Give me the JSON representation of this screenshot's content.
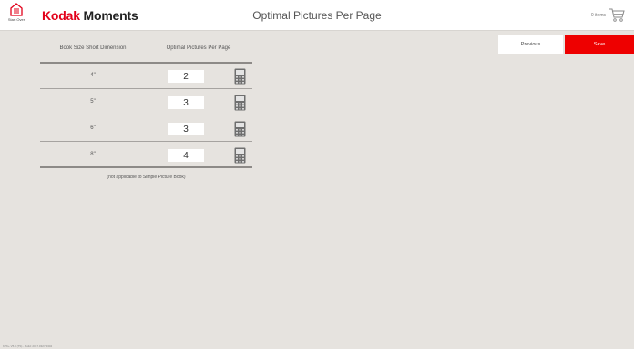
{
  "header": {
    "home_label": "Start Over",
    "brand_primary": "Kodak",
    "brand_secondary": "Moments",
    "title": "Optimal Pictures Per Page",
    "cart_count": "0 items"
  },
  "actions": {
    "previous_label": "Previous",
    "save_label": "Save"
  },
  "table": {
    "col_size": "Book Size Short Dimension",
    "col_optimal": "Optimal Pictures Per Page",
    "rows": [
      {
        "size": "4\"",
        "value": "2"
      },
      {
        "size": "5\"",
        "value": "3"
      },
      {
        "size": "6\"",
        "value": "3"
      },
      {
        "size": "8\"",
        "value": "4"
      }
    ],
    "note": "(not applicable to Simple Picture Book)"
  },
  "footer": {
    "build": "KPK+ V5.0 (TS) - Build: 2017.0327.2302"
  },
  "colors": {
    "brand_red": "#e2001a",
    "save_red": "#ee0000",
    "background": "#e6e3df"
  },
  "icons": {
    "home": "home-icon",
    "cart": "cart-icon",
    "calculator": "calculator-icon"
  }
}
